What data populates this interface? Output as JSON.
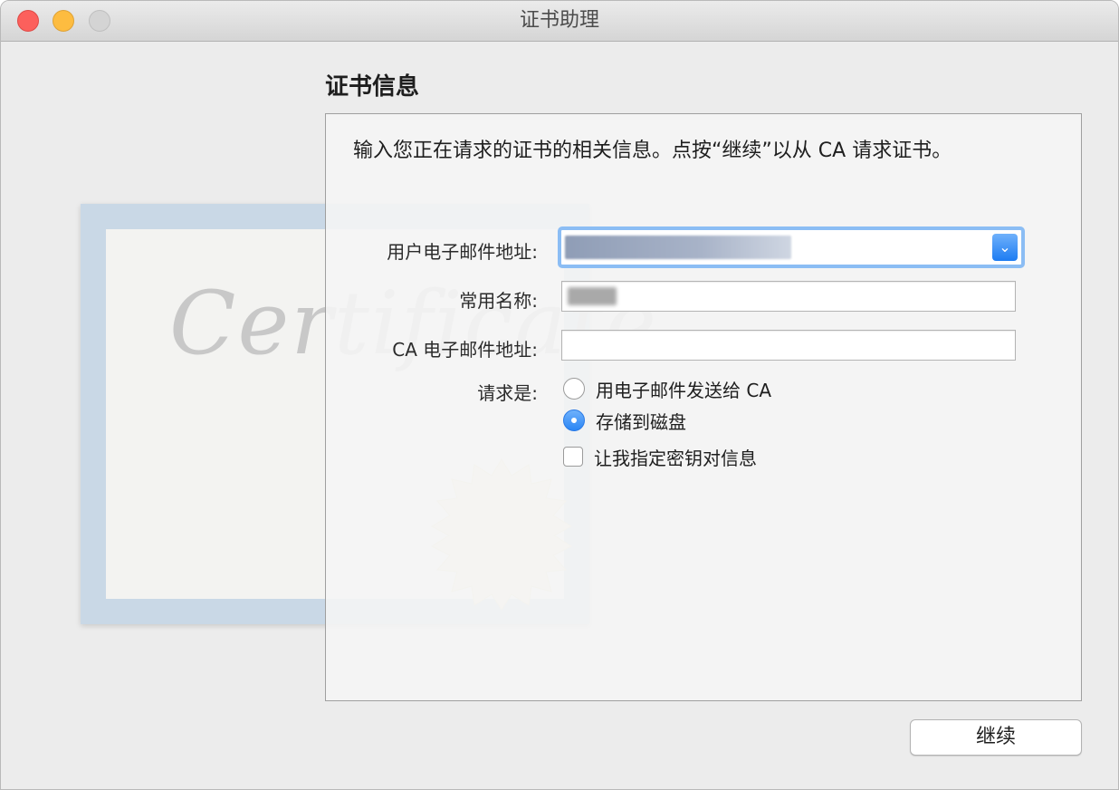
{
  "window": {
    "title": "证书助理"
  },
  "section": {
    "title": "证书信息",
    "description": "输入您正在请求的证书的相关信息。点按“继续”以从 CA 请求证书。"
  },
  "form": {
    "user_email_label": "用户电子邮件地址:",
    "user_email_value_note": "blurred",
    "common_name_label": "常用名称:",
    "ca_email_label": "CA 电子邮件地址:",
    "ca_email_value": "",
    "request_label": "请求是:",
    "options": [
      {
        "label": "用电子邮件发送给 CA",
        "selected": false
      },
      {
        "label": "存储到磁盘",
        "selected": true
      }
    ],
    "custom_key_label": "让我指定密钥对信息",
    "custom_key_checked": false
  },
  "illustration": {
    "watermark": "Certificate"
  },
  "footer": {
    "continue_label": "继续"
  },
  "colors": {
    "accent": "#2a86f5",
    "focus_ring": "#8bbdf4",
    "window_bg": "#ececec"
  }
}
